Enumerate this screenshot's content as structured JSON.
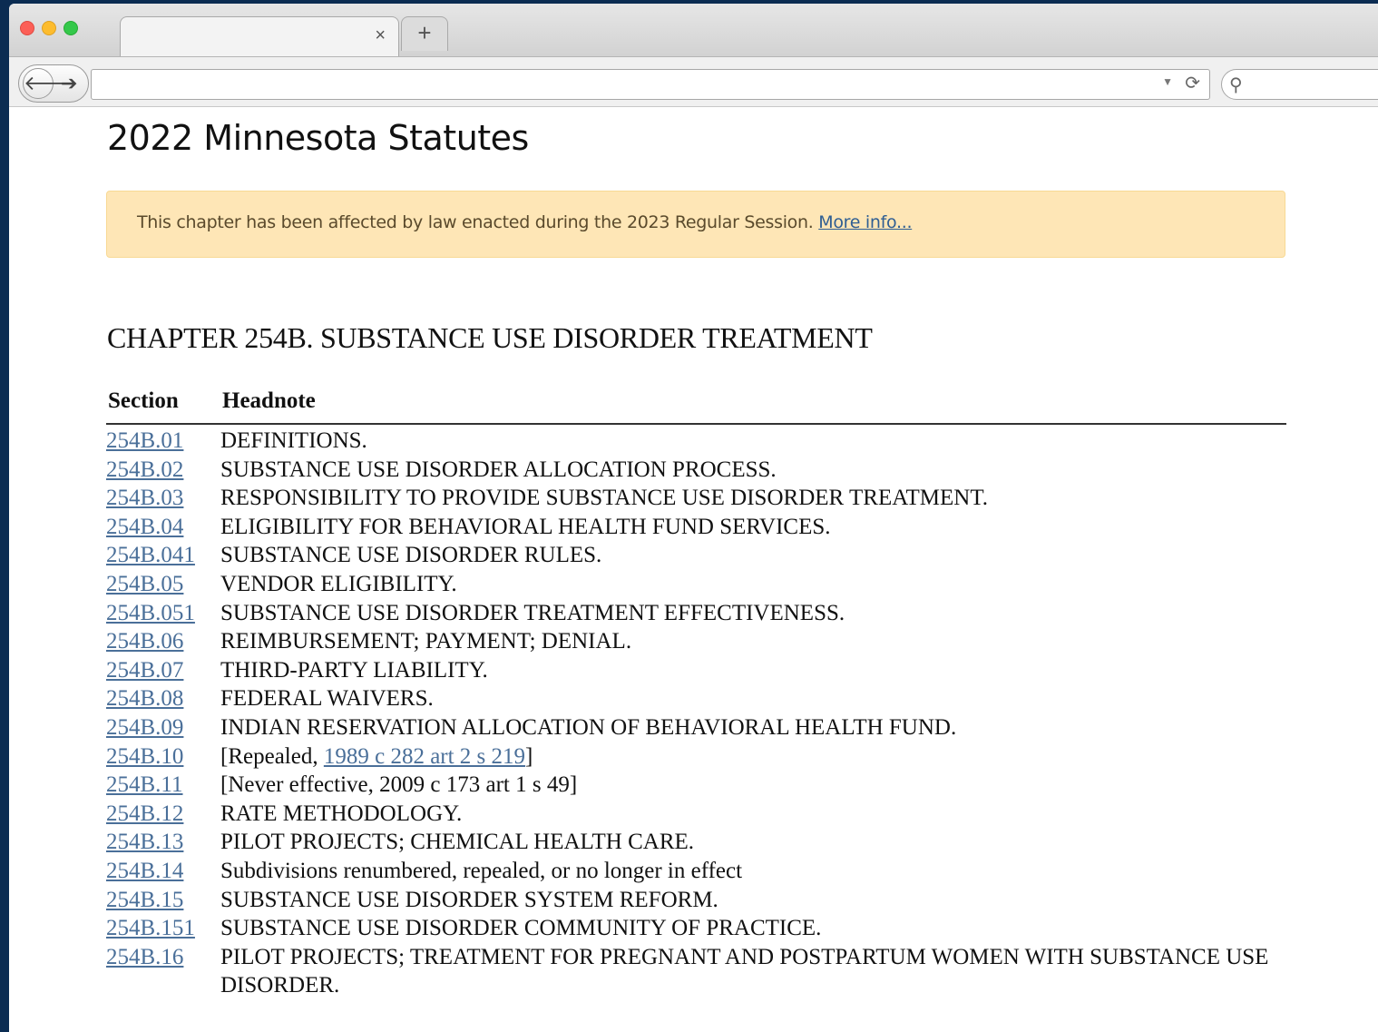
{
  "browser": {
    "tab_close": "×",
    "new_tab": "+",
    "back": "🡐",
    "forward": "➔",
    "url": "",
    "url_dropdown": "▼",
    "reload": "⟳",
    "search_icon": "⚲"
  },
  "page": {
    "title": "2022 Minnesota Statutes",
    "notice": {
      "text": "This chapter has been affected by law enacted during the 2023 Regular Session.",
      "link": "More info..."
    },
    "chapter_title": "CHAPTER 254B. SUBSTANCE USE DISORDER TREATMENT",
    "table": {
      "columns": [
        "Section",
        "Headnote"
      ],
      "rows": [
        {
          "section": "254B.01",
          "headnote": "DEFINITIONS."
        },
        {
          "section": "254B.02",
          "headnote": "SUBSTANCE USE DISORDER ALLOCATION PROCESS."
        },
        {
          "section": "254B.03",
          "headnote": "RESPONSIBILITY TO PROVIDE SUBSTANCE USE DISORDER TREATMENT."
        },
        {
          "section": "254B.04",
          "headnote": "ELIGIBILITY FOR BEHAVIORAL HEALTH FUND SERVICES."
        },
        {
          "section": "254B.041",
          "headnote": "SUBSTANCE USE DISORDER RULES."
        },
        {
          "section": "254B.05",
          "headnote": "VENDOR ELIGIBILITY."
        },
        {
          "section": "254B.051",
          "headnote": "SUBSTANCE USE DISORDER TREATMENT EFFECTIVENESS."
        },
        {
          "section": "254B.06",
          "headnote": "REIMBURSEMENT; PAYMENT; DENIAL."
        },
        {
          "section": "254B.07",
          "headnote": "THIRD-PARTY LIABILITY."
        },
        {
          "section": "254B.08",
          "headnote": "FEDERAL WAIVERS."
        },
        {
          "section": "254B.09",
          "headnote": "INDIAN RESERVATION ALLOCATION OF BEHAVIORAL HEALTH FUND."
        },
        {
          "section": "254B.10",
          "headnote_prefix": "[Repealed, ",
          "headnote_link": "1989 c 282 art 2 s 219",
          "headnote_suffix": "]"
        },
        {
          "section": "254B.11",
          "headnote": "[Never effective, 2009 c 173 art 1 s 49]"
        },
        {
          "section": "254B.12",
          "headnote": "RATE METHODOLOGY."
        },
        {
          "section": "254B.13",
          "headnote": "PILOT PROJECTS; CHEMICAL HEALTH CARE."
        },
        {
          "section": "254B.14",
          "headnote": "Subdivisions renumbered, repealed, or no longer in effect"
        },
        {
          "section": "254B.15",
          "headnote": "SUBSTANCE USE DISORDER SYSTEM REFORM."
        },
        {
          "section": "254B.151",
          "headnote": "SUBSTANCE USE DISORDER COMMUNITY OF PRACTICE."
        },
        {
          "section": "254B.16",
          "headnote": "PILOT PROJECTS; TREATMENT FOR PREGNANT AND POSTPARTUM WOMEN WITH SUBSTANCE USE DISORDER."
        }
      ]
    }
  }
}
